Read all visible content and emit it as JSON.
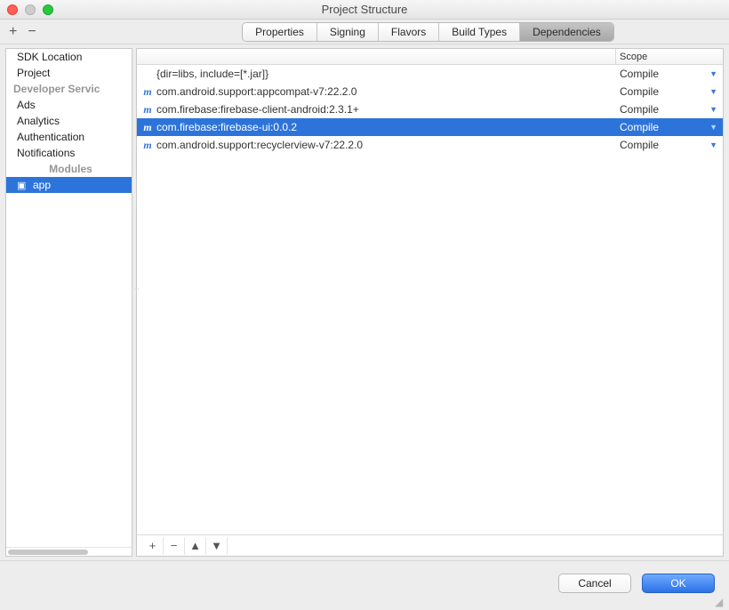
{
  "window": {
    "title": "Project Structure"
  },
  "toolbar": {
    "add_symbol": "+",
    "remove_symbol": "−"
  },
  "tabs": [
    {
      "label": "Properties",
      "active": false
    },
    {
      "label": "Signing",
      "active": false
    },
    {
      "label": "Flavors",
      "active": false
    },
    {
      "label": "Build Types",
      "active": false
    },
    {
      "label": "Dependencies",
      "active": true
    }
  ],
  "sidebar": {
    "items": [
      {
        "label": "SDK Location",
        "kind": "item"
      },
      {
        "label": "Project",
        "kind": "item"
      },
      {
        "label": "Developer Servic",
        "kind": "group"
      },
      {
        "label": "Ads",
        "kind": "item"
      },
      {
        "label": "Analytics",
        "kind": "item"
      },
      {
        "label": "Authentication",
        "kind": "item"
      },
      {
        "label": "Notifications",
        "kind": "item"
      },
      {
        "label": "Modules",
        "kind": "group-center"
      },
      {
        "label": "app",
        "kind": "module",
        "selected": true
      }
    ]
  },
  "table": {
    "headers": {
      "dep": "",
      "scope": "Scope"
    },
    "rows": [
      {
        "icon": "",
        "text": "{dir=libs, include=[*.jar]}",
        "scope": "Compile",
        "selected": false
      },
      {
        "icon": "m",
        "text": "com.android.support:appcompat-v7:22.2.0",
        "scope": "Compile",
        "selected": false
      },
      {
        "icon": "m",
        "text": "com.firebase:firebase-client-android:2.3.1+",
        "scope": "Compile",
        "selected": false
      },
      {
        "icon": "m",
        "text": "com.firebase:firebase-ui:0.0.2",
        "scope": "Compile",
        "selected": true
      },
      {
        "icon": "m",
        "text": "com.android.support:recyclerview-v7:22.2.0",
        "scope": "Compile",
        "selected": false
      }
    ],
    "toolbar": {
      "add": "+",
      "remove": "−",
      "up": "▲",
      "down": "▼"
    }
  },
  "footer": {
    "cancel": "Cancel",
    "ok": "OK"
  }
}
